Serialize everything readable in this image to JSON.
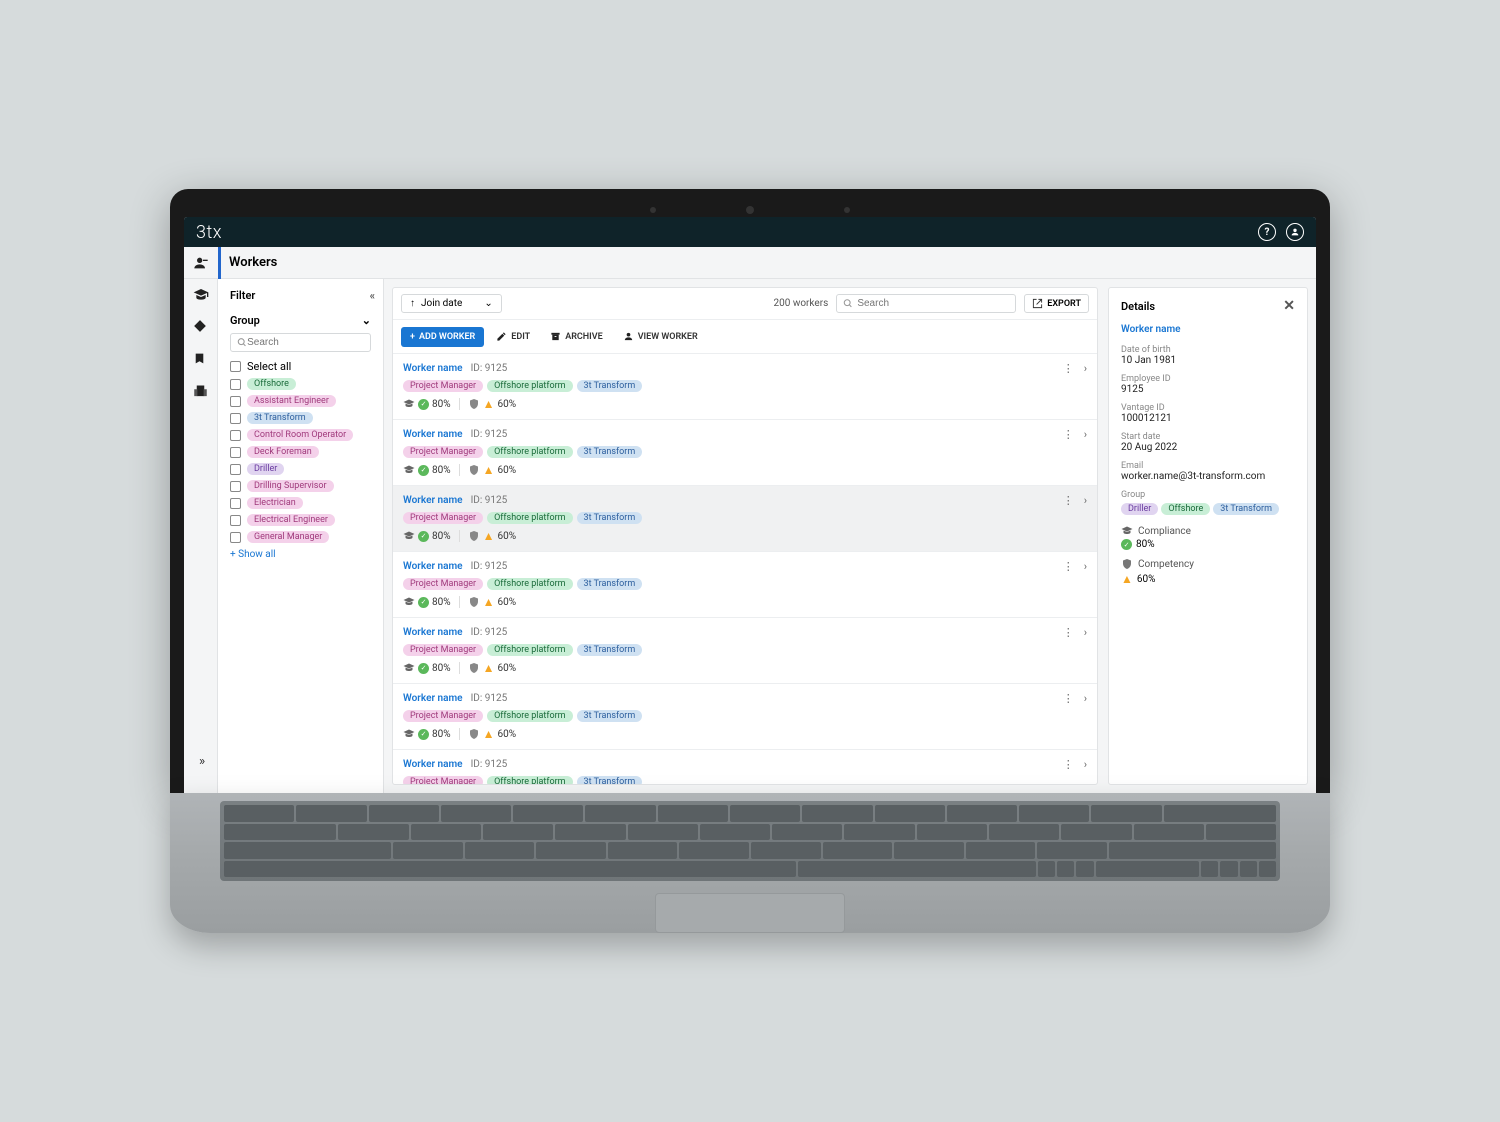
{
  "brand": "3tx",
  "page_title": "Workers",
  "filter": {
    "title": "Filter",
    "group_label": "Group",
    "search_placeholder": "Search",
    "select_all": "Select all",
    "items": [
      {
        "label": "Offshore",
        "color": "green"
      },
      {
        "label": "Assistant Engineer",
        "color": "pink"
      },
      {
        "label": "3t Transform",
        "color": "blue"
      },
      {
        "label": "Control Room Operator",
        "color": "pink"
      },
      {
        "label": "Deck Foreman",
        "color": "pink"
      },
      {
        "label": "Driller",
        "color": "purple"
      },
      {
        "label": "Drilling Supervisor",
        "color": "pink"
      },
      {
        "label": "Electrician",
        "color": "pink"
      },
      {
        "label": "Electrical Engineer",
        "color": "pink"
      },
      {
        "label": "General Manager",
        "color": "pink"
      }
    ],
    "show_all": "+ Show all"
  },
  "toolbar": {
    "sort_label": "Join date",
    "count": "200 workers",
    "search_placeholder": "Search",
    "export": "EXPORT",
    "add": "ADD WORKER",
    "edit": "EDIT",
    "archive": "ARCHIVE",
    "view": "VIEW WORKER"
  },
  "worker_row": {
    "name": "Worker name",
    "id_prefix": "ID:",
    "id": "9125",
    "tags": [
      {
        "label": "Project Manager",
        "color": "pink"
      },
      {
        "label": "Offshore platform",
        "color": "green"
      },
      {
        "label": "3t  Transform",
        "color": "blue"
      }
    ],
    "compliance_pct": "80%",
    "competency_pct": "60%"
  },
  "workers_indices": [
    0,
    1,
    2,
    3,
    4,
    5,
    6
  ],
  "selected_index": 2,
  "details": {
    "title": "Details",
    "name": "Worker name",
    "fields": [
      {
        "label": "Date of birth",
        "value": "10 Jan 1981"
      },
      {
        "label": "Employee ID",
        "value": "9125"
      },
      {
        "label": "Vantage ID",
        "value": "100012121"
      },
      {
        "label": "Start date",
        "value": "20 Aug 2022"
      },
      {
        "label": "Email",
        "value": "worker.name@3t-transform.com"
      }
    ],
    "group_label": "Group",
    "groups": [
      {
        "label": "Driller",
        "color": "purple"
      },
      {
        "label": "Offshore",
        "color": "green"
      },
      {
        "label": "3t Transform",
        "color": "blue"
      }
    ],
    "compliance_label": "Compliance",
    "compliance_value": "80%",
    "competency_label": "Competency",
    "competency_value": "60%"
  }
}
